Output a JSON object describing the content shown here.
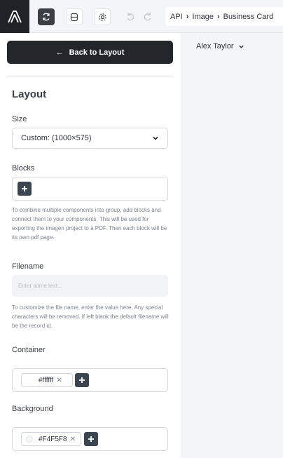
{
  "toolbar": {
    "logo_icon": "app-logo-a",
    "tools": [
      {
        "name": "sync-icon",
        "state": "active"
      },
      {
        "name": "database-icon",
        "state": "plain"
      },
      {
        "name": "gear-icon",
        "state": "plain"
      },
      {
        "name": "undo-icon",
        "state": "disabled"
      },
      {
        "name": "redo-icon",
        "state": "disabled"
      }
    ],
    "breadcrumb": [
      "API",
      "Image",
      "Business Card"
    ]
  },
  "left_panel": {
    "back_button": "Back to Layout",
    "heading": "Layout",
    "size": {
      "label": "Size",
      "selected": "Custom: (1000×575)"
    },
    "blocks": {
      "label": "Blocks",
      "help": "To combine multiple components into group, add blocks and connect them to your components. This will be used for exporting the imagen project to a PDF. Then each block will be its own pdf page."
    },
    "filename": {
      "label": "Filename",
      "value": "",
      "placeholder": "Enter some text...",
      "help": "To customize the file name, enter the value here. Any special characters will be removed. If left blank the default filename will be the record id."
    },
    "container": {
      "label": "Container",
      "color": "#ffffff"
    },
    "background": {
      "label": "Background",
      "color": "#F4F5F8"
    }
  },
  "right_panel": {
    "user_name": "Alex Taylor"
  },
  "colors": {
    "dark": "#1f2226",
    "button": "#23262b",
    "plus": "#3a4550",
    "canvas": "#f3f5f8"
  }
}
